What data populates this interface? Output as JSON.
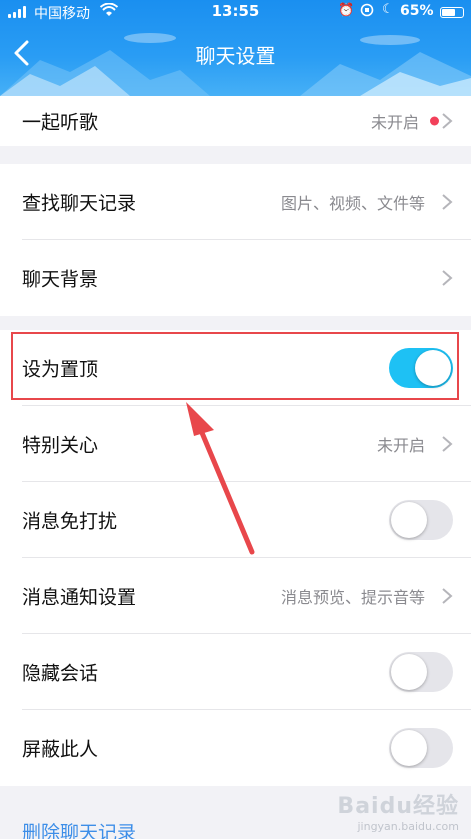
{
  "status_bar": {
    "carrier": "中国移动",
    "time": "13:55",
    "battery": "65%"
  },
  "header": {
    "title": "聊天设置"
  },
  "settings": {
    "listen_together": {
      "label": "一起听歌",
      "value": "未开启",
      "has_dot": true
    },
    "find_history": {
      "label": "查找聊天记录",
      "value": "图片、视频、文件等"
    },
    "chat_background": {
      "label": "聊天背景"
    },
    "pin_top": {
      "label": "设为置顶",
      "enabled": true
    },
    "special_care": {
      "label": "特别关心",
      "value": "未开启"
    },
    "do_not_disturb": {
      "label": "消息免打扰",
      "enabled": false
    },
    "notification_settings": {
      "label": "消息通知设置",
      "value": "消息预览、提示音等"
    },
    "hide_session": {
      "label": "隐藏会话",
      "enabled": false
    },
    "block_user": {
      "label": "屏蔽此人",
      "enabled": false
    }
  },
  "footer": {
    "delete_history": "删除聊天记录"
  },
  "watermark": {
    "brand": "Baidu经验",
    "url": "jingyan.baidu.com"
  },
  "colors": {
    "header_blue": "#2a9df4",
    "toggle_on": "#1ec1f4",
    "highlight_red": "#e8474b",
    "link_blue": "#3d8ee8",
    "badge_red": "#f2405a"
  }
}
